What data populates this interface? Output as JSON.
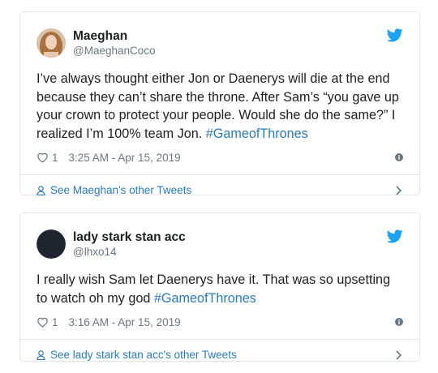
{
  "tweets": [
    {
      "author_name": "Maeghan",
      "author_handle": "@MaeghanCoco",
      "text_parts": [
        "I’ve always thought either Jon or Daenerys will die at the end because they can’t share the throne. After Sam’s “you gave up your crown to protect your people. Would she do the same?” I realized I’m 100% team Jon. ",
        "#GameofThrones"
      ],
      "like_count": "1",
      "timestamp": "3:25 AM - Apr 15, 2019",
      "footer_link": "See Maeghan's other Tweets",
      "avatar_icon": "avatar-photo-icon"
    },
    {
      "author_name": "lady stark stan acc",
      "author_handle": "@lhxo14",
      "text_parts": [
        "I really wish Sam let Daenerys have it. That was so upsetting to watch oh my god  ",
        "#GameofThrones"
      ],
      "like_count": "1",
      "timestamp": "3:16 AM - Apr 15, 2019",
      "footer_link": "See lady stark stan acc's other Tweets",
      "avatar_icon": "avatar-dark-icon"
    }
  ],
  "colors": {
    "link": "#2b7bb9",
    "twitter_blue": "#1da1f2",
    "muted": "#697882",
    "border": "#e1e8ed"
  },
  "icons": [
    "twitter-bird-icon",
    "heart-icon",
    "info-icon",
    "person-icon",
    "chevron-right-icon"
  ]
}
